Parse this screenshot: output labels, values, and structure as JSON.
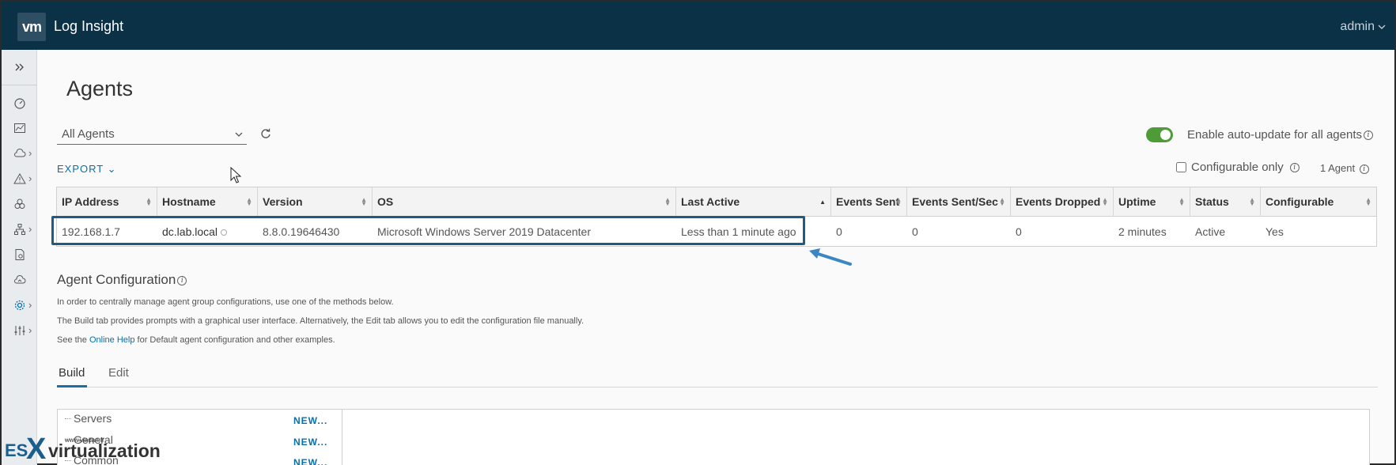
{
  "header": {
    "logo": "vm",
    "title": "Log Insight",
    "user": "admin"
  },
  "sidebar": {
    "items": [
      {
        "icon": "expand-icon"
      },
      {
        "icon": "dashboard-icon"
      },
      {
        "icon": "chart-icon"
      },
      {
        "icon": "cloud-icon"
      },
      {
        "icon": "alert-icon"
      },
      {
        "icon": "content-pack-icon"
      },
      {
        "icon": "hierarchy-icon"
      },
      {
        "icon": "agent-icon"
      },
      {
        "icon": "cloud-sync-icon"
      },
      {
        "icon": "gear-icon"
      },
      {
        "icon": "sliders-icon"
      }
    ]
  },
  "page": {
    "title": "Agents"
  },
  "filter": {
    "selected": "All Agents"
  },
  "auto_update": {
    "label": "Enable auto-update for all agents",
    "enabled": true
  },
  "export_label": "EXPORT",
  "configurable_only": {
    "label": "Configurable only",
    "checked": false
  },
  "agent_count": "1 Agent",
  "table": {
    "columns": [
      "IP Address",
      "Hostname",
      "Version",
      "OS",
      "Last Active",
      "Events Sent",
      "Events Sent/Sec",
      "Events Dropped",
      "Uptime",
      "Status",
      "Configurable"
    ],
    "rows": [
      [
        "192.168.1.7",
        "dc.lab.local",
        "8.8.0.19646430",
        "Microsoft Windows Server 2019 Datacenter",
        "Less than 1 minute ago",
        "0",
        "0",
        "0",
        "2 minutes",
        "Active",
        "Yes"
      ]
    ]
  },
  "config": {
    "title": "Agent Configuration",
    "line1": "In order to centrally manage agent group configurations, use one of the methods below.",
    "line2": "The Build tab provides prompts with a graphical user interface. Alternatively, the Edit tab allows you to edit the configuration file manually.",
    "line3_pre": "See the ",
    "line3_link": "Online Help",
    "line3_post": " for Default agent configuration and other examples."
  },
  "tabs": [
    "Build",
    "Edit"
  ],
  "builder": {
    "items": [
      "Servers",
      "General",
      "Common"
    ],
    "new_label": "NEW..."
  },
  "watermark": {
    "es": "ES",
    "x": "X",
    "text": "virtualization",
    "url": "www.vladan.fr"
  },
  "colors": {
    "header_bg": "#0b3147",
    "accent": "#0a6fa9",
    "toggle_on": "#4f9b38",
    "highlight": "#1d5c86"
  }
}
